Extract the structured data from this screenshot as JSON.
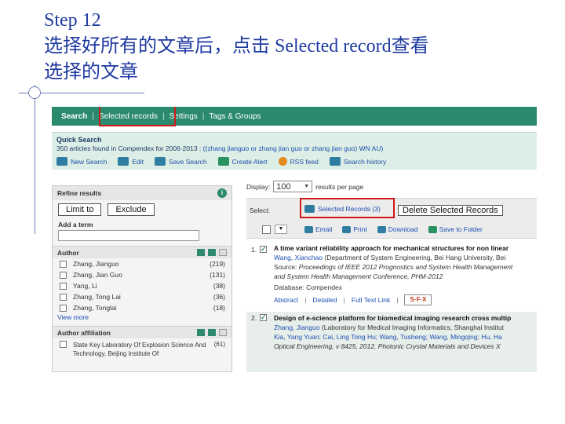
{
  "slide": {
    "title_line1": "Step 12",
    "title_line2": "选择好所有的文章后，点击 Selected record查看",
    "title_line3": "选择的文章"
  },
  "nav": {
    "tabs": [
      "Search",
      "Selected records",
      "Settings",
      "Tags & Groups"
    ],
    "separator": "|"
  },
  "quick_search": {
    "title": "Quick Search",
    "info_prefix": "350 articles found in Compendex for 2006-2013 : ",
    "info_query": "((zhang jianguo or zhang jian guo or zhang jian guo) WN AU)",
    "actions": [
      "New Search",
      "Edit",
      "Save Search",
      "Create Alert",
      "RSS feed",
      "Search history"
    ]
  },
  "display": {
    "label": "Display:",
    "value": "100",
    "suffix": "results per page"
  },
  "refine": {
    "title": "Refine results",
    "limit_to": "Limit to",
    "exclude": "Exclude",
    "add_term": "Add a term",
    "author_heading": "Author",
    "authors": [
      {
        "name": "Zhang, Jianguo",
        "count": "(219)"
      },
      {
        "name": "Zhang, Jian Guo",
        "count": "(131)"
      },
      {
        "name": "Yang, Li",
        "count": "(38)"
      },
      {
        "name": "Zhang, Tong Lai",
        "count": "(36)"
      },
      {
        "name": "Zhang, Tonglai",
        "count": "(18)"
      }
    ],
    "view_more": "View more",
    "affiliation_heading": "Author affiliation",
    "affiliation": {
      "name": "State Key Laboratory Of Explosion Science And Technology, Beijing Institute Of",
      "count": "(61)"
    }
  },
  "results_toolbar": {
    "select_label": "Select:",
    "selected_records": "Selected Records (3)",
    "delete_selected": "Delete Selected Records",
    "actions": [
      "Email",
      "Print",
      "Download",
      "Save to Folder"
    ]
  },
  "records": [
    {
      "num": "1.",
      "title": "A time variant reliability approach for mechanical structures for non linear",
      "authors": "Wang, Xianchao",
      "affiliation": " (Department of System Engineering, Bei Hang University, Bei",
      "source_label": " Source: ",
      "source": "Proceedings of IEEE 2012 Prognostics and System Health Management",
      "source2": "and System Health Management Conference, PHM-2012",
      "database": "Database: Compendex",
      "links": [
        "Abstract",
        "Detailed",
        "Full Text Link"
      ],
      "sfx": "S·F·X"
    },
    {
      "num": "2.",
      "title": "Design of e-science platform for biomedical imaging research cross multip",
      "authors": "Zhang, Jianguo",
      "affiliation": " (Laboratory for Medical Imaging Informatics, Shanghai Institut",
      "authors2": "Kia, Yang Yuan; Cai, Ling Tong Hu; Wang, Tusheng; Wang, Mingqing; Hu, Ha",
      "source": "Optical Engineering, v 8425, 2012, Photonic Crystal Materials and Devices X"
    }
  ]
}
